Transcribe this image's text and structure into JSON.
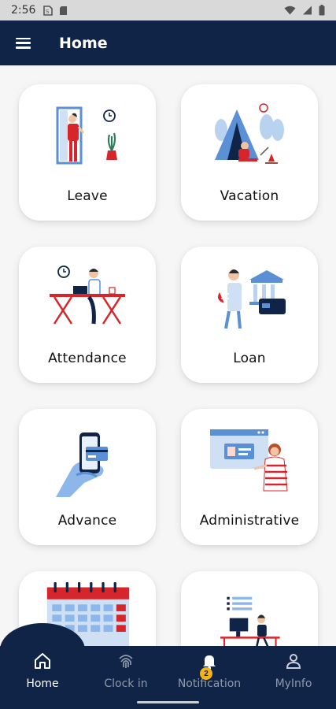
{
  "status_bar": {
    "time": "2:56",
    "icons": [
      "sim-icon",
      "sd-card-icon",
      "wifi-icon",
      "signal-icon",
      "battery-icon"
    ]
  },
  "app_bar": {
    "title": "Home",
    "menu_icon": "hamburger-menu-icon"
  },
  "tiles": [
    {
      "label": "Leave",
      "illustration": "person-leaving-door"
    },
    {
      "label": "Vacation",
      "illustration": "camping-tent"
    },
    {
      "label": "Attendance",
      "illustration": "person-at-desk-clock"
    },
    {
      "label": "Loan",
      "illustration": "person-with-money-bank"
    },
    {
      "label": "Advance",
      "illustration": "hand-with-phone-card"
    },
    {
      "label": "Administrative",
      "illustration": "person-with-browser"
    },
    {
      "label": "",
      "illustration": "calendar"
    },
    {
      "label": "",
      "illustration": "person-at-computer"
    }
  ],
  "bottom_nav": {
    "items": [
      {
        "label": "Home",
        "icon": "home-icon",
        "active": true
      },
      {
        "label": "Clock in",
        "icon": "fingerprint-icon",
        "active": false
      },
      {
        "label": "Notification",
        "icon": "bell-icon",
        "active": false,
        "badge": "2"
      },
      {
        "label": "MyInfo",
        "icon": "user-icon",
        "active": false
      }
    ]
  },
  "colors": {
    "primary": "#0f2447",
    "accent_red": "#d7262b",
    "accent_blue": "#5b8fd6",
    "badge": "#f2b519",
    "background": "#f6f6f7"
  }
}
